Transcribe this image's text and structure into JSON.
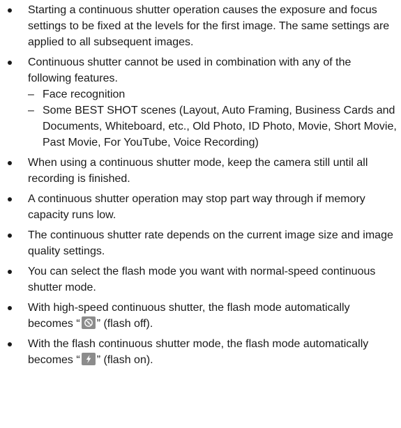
{
  "bullets": [
    {
      "text": "Starting a continuous shutter operation causes the exposure and focus settings to be fixed at the levels for the first image. The same settings are applied to all subsequent images."
    },
    {
      "text": "Continuous shutter cannot be used in combination with any of the following features.",
      "dash_marker": "–",
      "sub": [
        "Face recognition",
        "Some BEST SHOT scenes (Layout, Auto Framing, Business Cards and Documents, Whiteboard, etc., Old Photo, ID Photo, Movie, Short Movie, Past Movie, For YouTube, Voice Recording)"
      ]
    },
    {
      "text": "When using a continuous shutter mode, keep the camera still until all recording is finished."
    },
    {
      "text": "A continuous shutter operation may stop part way through if memory capacity runs low."
    },
    {
      "text": "The continuous shutter rate depends on the current image size and image quality settings."
    },
    {
      "text": "You can select the flash mode you want with normal-speed continuous shutter mode."
    },
    {
      "before": "With high-speed continuous shutter, the flash mode automatically becomes “",
      "icon": "flash-off-icon",
      "after": "” (flash off)."
    },
    {
      "before": "With the flash continuous shutter mode, the flash mode automatically becomes “",
      "icon": "flash-on-icon",
      "after": "” (flash on)."
    }
  ],
  "colors": {
    "text": "#1a1a1a",
    "icon_background": "#8c8c8c",
    "icon_foreground": "#ffffff"
  }
}
